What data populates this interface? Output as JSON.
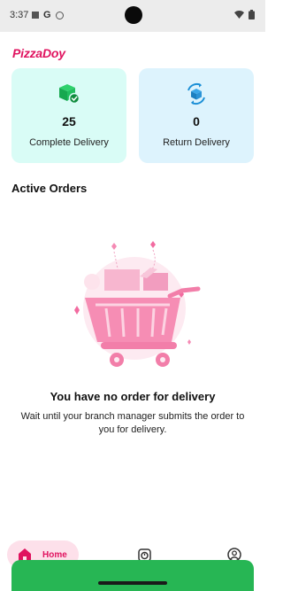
{
  "status_bar": {
    "time": "3:37",
    "icons_left": [
      "notification-square-icon",
      "google-g-icon",
      "status-circle-icon"
    ],
    "icons_right": [
      "wifi-icon",
      "battery-icon"
    ]
  },
  "header": {
    "brand": "PizzaDoy"
  },
  "stats": {
    "complete": {
      "count": "25",
      "label": "Complete Delivery",
      "icon": "box-check-icon",
      "bg": "#d9fcf6",
      "accent": "#1db954"
    },
    "return": {
      "count": "0",
      "label": "Return Delivery",
      "icon": "box-return-icon",
      "bg": "#ddf3fd",
      "accent": "#1c8fd6"
    }
  },
  "active_orders": {
    "title": "Active Orders",
    "empty_title": "You have no order for delivery",
    "empty_description": "Wait until your branch manager submits the order to you for delivery.",
    "illustration": "empty-cart-illustration"
  },
  "bottom_nav": {
    "items": [
      {
        "label": "Home",
        "icon": "home-icon",
        "active": true
      },
      {
        "label": "",
        "icon": "timer-icon",
        "active": false
      },
      {
        "label": "",
        "icon": "profile-icon",
        "active": false
      }
    ],
    "accent": "#e0135f"
  },
  "colors": {
    "brand": "#e0135f",
    "action": "#27b654"
  }
}
